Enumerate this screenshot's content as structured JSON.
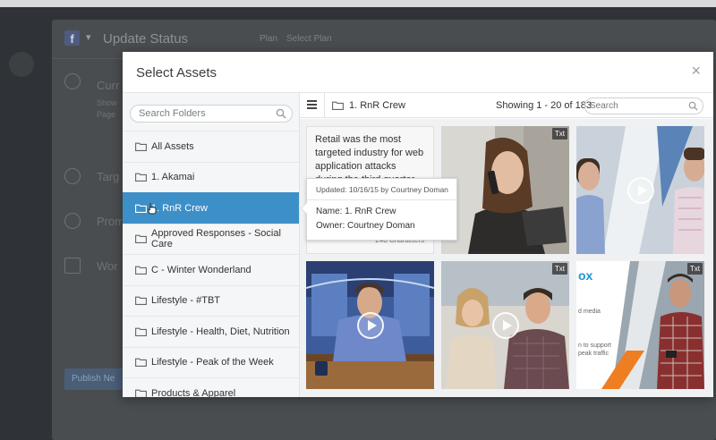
{
  "background": {
    "window_title": "Update Status",
    "plan_label": "Plan",
    "plan_select": "Select Plan",
    "rows": [
      "Curr",
      "Targ",
      "Prom",
      "Wor"
    ],
    "row_sub1": "Show",
    "row_sub2": "Page",
    "publish_label": "Publish Ne"
  },
  "modal": {
    "title": "Select Assets",
    "close_glyph": "×"
  },
  "folders": {
    "search_placeholder": "Search Folders",
    "items": [
      {
        "label": "All Assets"
      },
      {
        "label": "1. Akamai"
      },
      {
        "label": "1. RnR Crew"
      },
      {
        "label": "Approved Responses - Social Care"
      },
      {
        "label": "C - Winter Wonderland"
      },
      {
        "label": "Lifestyle - #TBT"
      },
      {
        "label": "Lifestyle - Health, Diet, Nutrition"
      },
      {
        "label": "Lifestyle - Peak of the Week"
      },
      {
        "label": "Products & Apparel"
      }
    ],
    "active_index": 2
  },
  "toolbar": {
    "folder_name": "1. RnR Crew",
    "showing": "Showing 1 - 20 of 183",
    "search_placeholder": "Search"
  },
  "assets": {
    "text_tile": {
      "text": "Retail was the most targeted industry for web application attacks during the third quarter of 2015",
      "char_count": "248 Characters"
    },
    "badge_txt": "Txt",
    "media_text_fragments": {
      "logo": "ox",
      "line1": "d media",
      "line2": "n to support",
      "line3": "peak traffic"
    }
  },
  "tooltip": {
    "updated": "Updated: 10/16/15 by Courtney Doman",
    "name": "Name: 1. RnR Crew",
    "owner": "Owner: Courtney Doman"
  },
  "colors": {
    "accent": "#3d8fc8",
    "overlay": "#2f3236"
  }
}
